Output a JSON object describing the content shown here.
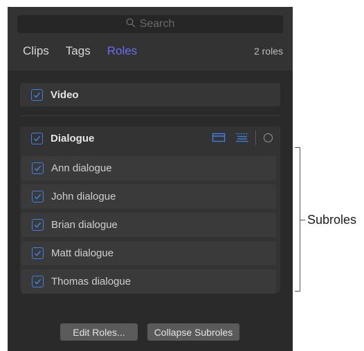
{
  "search": {
    "placeholder": "Search"
  },
  "tabs": [
    {
      "label": "Clips",
      "active": false
    },
    {
      "label": "Tags",
      "active": false
    },
    {
      "label": "Roles",
      "active": true
    }
  ],
  "roles_count": "2 roles",
  "roles": {
    "video": {
      "label": "Video",
      "checked": true
    },
    "dialogue": {
      "label": "Dialogue",
      "checked": true,
      "subroles": [
        {
          "label": "Ann dialogue",
          "checked": true
        },
        {
          "label": "John dialogue",
          "checked": true
        },
        {
          "label": "Brian dialogue",
          "checked": true
        },
        {
          "label": "Matt dialogue",
          "checked": true
        },
        {
          "label": "Thomas dialogue",
          "checked": true
        }
      ]
    }
  },
  "buttons": {
    "edit_roles": "Edit Roles...",
    "collapse_subroles": "Collapse Subroles"
  },
  "annotation": {
    "label": "Subroles"
  },
  "colors": {
    "accent": "#6f6cf2",
    "checkbox": "#3f82e6",
    "panel_bg": "#2a2a2a"
  }
}
